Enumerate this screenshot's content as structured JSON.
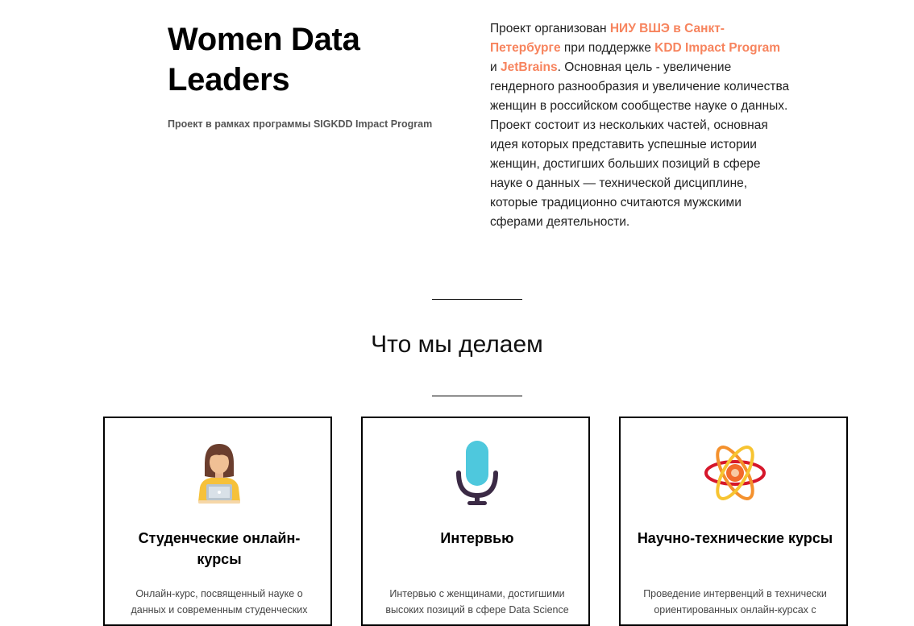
{
  "hero": {
    "title": "Women Data Leaders",
    "subtitle": "Проект в рамках программы SIGKDD Impact Program"
  },
  "about": {
    "part1": "Проект организован ",
    "link_hse": "НИУ ВШЭ в Санкт-Петербурге",
    "part2": " при поддержке ",
    "link_kdd": "KDD Impact Program",
    "part3": " и ",
    "link_jetbrains": "JetBrains",
    "part4": ". Основная цель - увеличение гендерного разнообразия и увеличение количества женщин в российском сообществе науке о данных. Проект состоит из нескольких частей, основная идея которых представить успешные истории женщин, достигших больших позиций в сфере науке о данных — технической дисциплине, которые традиционно считаются мужскими сферами деятельности."
  },
  "section": {
    "title": "Что мы делаем"
  },
  "cards": [
    {
      "icon": "student-laptop-icon",
      "title": "Студенческие онлайн-курсы",
      "text": "Онлайн-курс, посвященный науке о данных и современным студенческих"
    },
    {
      "icon": "microphone-icon",
      "title": "Интервью",
      "text": "Интервью с женщинами, достигшими высоких позиций в сфере Data Science"
    },
    {
      "icon": "atom-icon",
      "title": "Научно-технические курсы",
      "text": "Проведение интервенций в технически ориентированных онлайн-курсах с"
    }
  ],
  "colors": {
    "accent": "#f7845e",
    "text": "#222222",
    "border": "#000000"
  }
}
